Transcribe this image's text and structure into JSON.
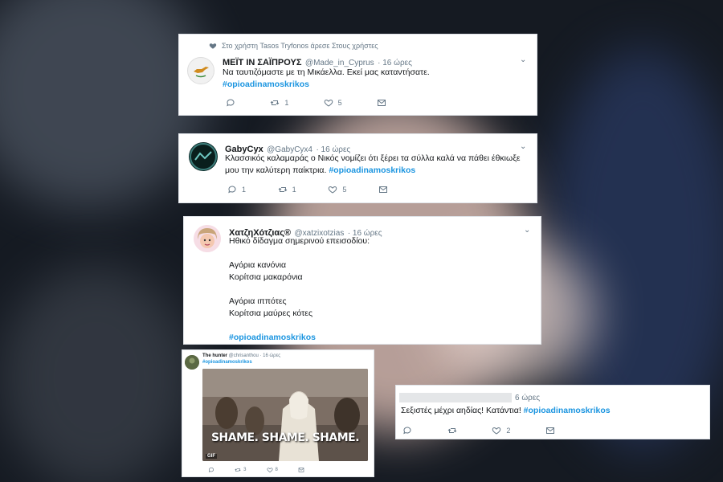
{
  "tweet1": {
    "retweet_notice": "Στο χρήστη Tasos Tryfonos άρεσε Στους χρήστες",
    "name": "ΜΕΪΤ ΙΝ ΣΑΪΠΡΟΥΣ",
    "handle": "@Made_in_Cyprus",
    "time": "· 16 ώρες",
    "text": "Να ταυτιζόμαστε με τη Μικάελλα. Εκεί μας καταντήσατε.",
    "hashtag": "#opioadinamoskrikos",
    "retweets": "1",
    "likes": "5"
  },
  "tweet2": {
    "name": "GabyCyx",
    "handle": "@GabyCyx4",
    "time": "· 16 ώρες",
    "text_line1": "Κλασσικός καλαμαράς ο Νικός νομίζει ότι ξέρει τα σύλλα καλά να πάθει έθκιωξε",
    "text_line2": "μου την καλύτερη παίκτρια.",
    "hashtag": "#opioadinamoskrikos",
    "replies": "1",
    "retweets": "1",
    "likes": "5"
  },
  "tweet3": {
    "name": "ΧατζηΧότζιας®",
    "handle": "@xatzixotzias",
    "time": "· 16 ώρες",
    "line1": "Ηθικό δίδαγμα σημερινού επεισοδίου:",
    "line2": "Αγόρια κανόνια",
    "line3": "Κορίτσια μακαρόνια",
    "line4": "Αγόρια ιππότες",
    "line5": "Κορίτσια μαύρες κότες",
    "hashtag": "#opioadinamoskrikos"
  },
  "tweet4": {
    "name": "The hunter",
    "handle": "@chrisanthou",
    "time": "· 16 ώρες",
    "hashtag": "#opioadinamoskrikos",
    "gif_caption": "SHAME. SHAME. SHAME.",
    "gif_badge": "GIF",
    "retweets": "3",
    "likes": "8"
  },
  "tweet5": {
    "time": "6 ώρες",
    "text": "Σεξιστές μέχρι αηδίας! Κατάντια!",
    "hashtag": "#opioadinamoskrikos",
    "likes": "2"
  },
  "colors": {
    "hashtag": "#1b95e0",
    "muted": "#657786",
    "text": "#14171a"
  }
}
